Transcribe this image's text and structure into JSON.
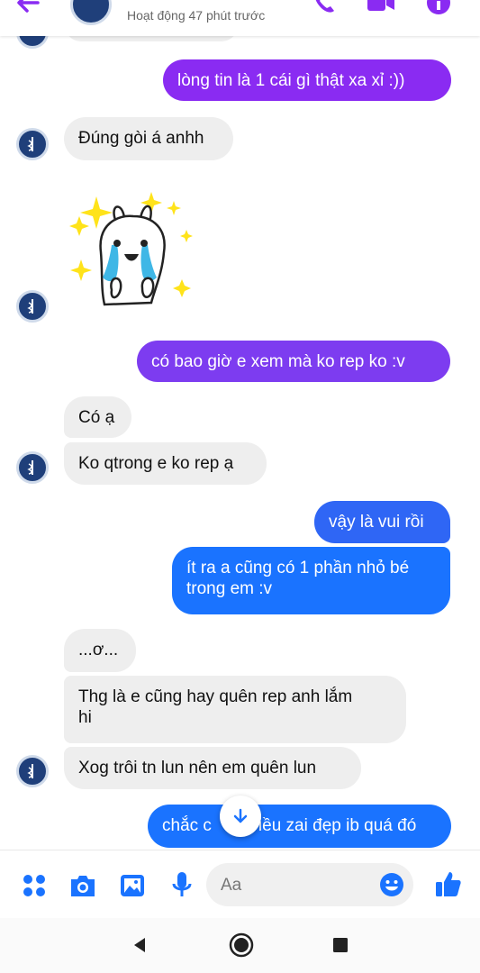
{
  "header": {
    "status": "Hoạt động 47 phút trước"
  },
  "messages": [
    {
      "text": "lòng tin là 1 cái gì thật xa xỉ :))",
      "side": "out"
    },
    {
      "text": "Đúng gòi á anhh",
      "side": "in"
    },
    {
      "text": "có bao giờ e xem mà ko rep ko :v",
      "side": "out"
    },
    {
      "text": "Có ạ",
      "side": "in"
    },
    {
      "text": "Ko qtrong e ko rep ạ",
      "side": "in"
    },
    {
      "text": "vậy là vui rồi",
      "side": "out"
    },
    {
      "text": "ít ra a cũng có 1 phần nhỏ bé",
      "side": "out"
    },
    {
      "text": "trong em :v",
      "side": "out"
    },
    {
      "text": "...ơ...",
      "side": "in"
    },
    {
      "text": "Thg là e cũng hay quên rep anh lắm",
      "side": "in"
    },
    {
      "text": "hi",
      "side": "in"
    },
    {
      "text": "Xog trôi tn lun nên em quên lun",
      "side": "in"
    },
    {
      "text": "chắc c",
      "side": "out"
    },
    {
      "text": "iều zai đẹp ib quá đó",
      "side": "out"
    }
  ],
  "composer": {
    "placeholder": "Aa"
  },
  "colors": {
    "accent_purple": "#8a2bf2",
    "accent_violet": "#7d3cf0",
    "accent_blue": "#1a73ff",
    "incoming_bubble": "#eeeeee"
  },
  "icons": [
    "back-arrow-icon",
    "phone-icon",
    "video-icon",
    "info-icon",
    "menu-dots-icon",
    "camera-icon",
    "image-icon",
    "mic-icon",
    "emoji-icon",
    "thumbs-up-icon",
    "scroll-down-icon",
    "nav-back-icon",
    "nav-home-icon",
    "nav-recents-icon"
  ]
}
